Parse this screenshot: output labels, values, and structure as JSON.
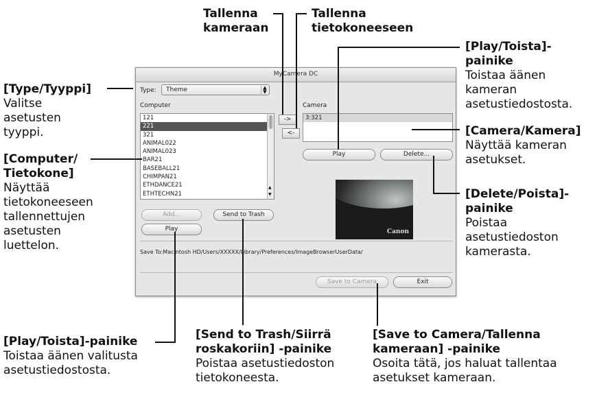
{
  "window": {
    "title": "MyCamera DC"
  },
  "type_field": {
    "label": "Type:",
    "value": "Theme"
  },
  "computer_list": {
    "header": "Computer",
    "items": [
      "121",
      "221",
      "321",
      "ANIMAL022",
      "ANIMAL023",
      "BAR21",
      "BASEBALL21",
      "CHIMPAN21",
      "ETHDANCE21",
      "ETHTECHN21"
    ],
    "selected_index": 1
  },
  "camera_list": {
    "header": "Camera",
    "items": [
      "3:321"
    ]
  },
  "transfer_buttons": {
    "to_camera": "->",
    "to_computer": "<-"
  },
  "buttons": {
    "add": "Add...",
    "send_to_trash": "Send to Trash",
    "play_computer": "Play",
    "play_camera": "Play",
    "delete": "Delete...",
    "save_to_camera": "Save to Camera",
    "exit": "Exit"
  },
  "preview": {
    "logo_text": "Canon"
  },
  "save_path": "Save To:Macintosh HD/Users/XXXXX/Library/Preferences/ImageBrowserUserData/",
  "annotations": {
    "save_to_camera_top": {
      "title": "Tallenna\nkameraan"
    },
    "save_to_computer_top": {
      "title": "Tallenna\ntietokoneeseen"
    },
    "play_camera": {
      "title": "[Play/Toista]-\npainike",
      "desc": "Toistaa äänen\nkameran\nasetustiedostosta."
    },
    "camera": {
      "title": "[Camera/Kamera]",
      "desc": "Näyttää kameran\nasetukset."
    },
    "delete": {
      "title": "[Delete/Poista]-\npainike",
      "desc": "Poistaa\nasetustiedoston\nkamerasta."
    },
    "type": {
      "title": "[Type/Tyyppi]",
      "desc": "Valitse\nasetusten\ntyyppi."
    },
    "computer": {
      "title": "[Computer/\nTietokone]",
      "desc": "Näyttää\ntietokoneeseen\ntallennettujen\nasetusten\nluettelon."
    },
    "play_computer": {
      "title": "[Play/Toista]-painike",
      "desc": "Toistaa äänen valitusta\nasetustiedostosta."
    },
    "send_to_trash": {
      "title": "[Send to Trash/Siirrä\nroskakoriin] -painike",
      "desc": "Poistaa asetustiedoston\ntietokoneesta."
    },
    "save_to_camera": {
      "title": "[Save to Camera/Tallenna\nkameraan] -painike",
      "desc": "Osoita tätä, jos haluat tallentaa\nasetukset kameraan."
    }
  }
}
